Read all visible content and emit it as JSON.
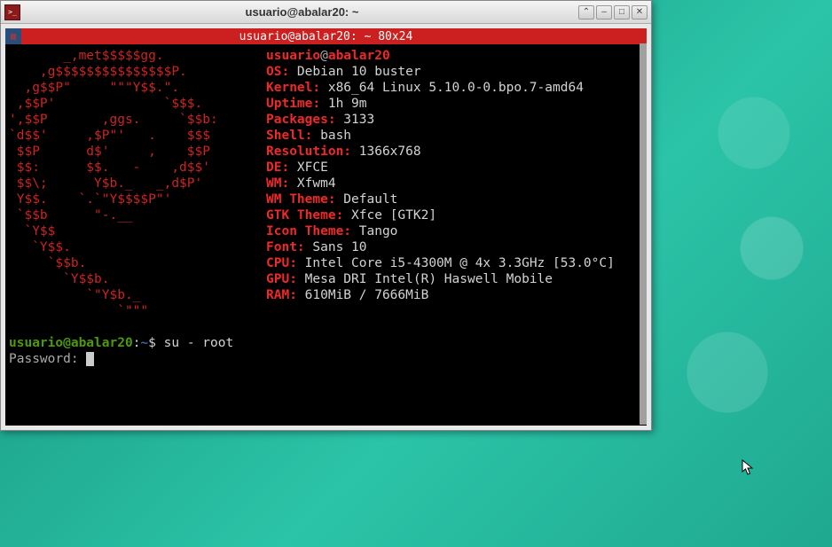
{
  "window": {
    "title": "usuario@abalar20: ~",
    "controls": {
      "up": "⌃",
      "min": "–",
      "max": "□",
      "close": "✕"
    }
  },
  "tab": {
    "title": "usuario@abalar20: ~ 80x24"
  },
  "fetch": {
    "ascii": [
      "       _,met$$$$$gg.",
      "    ,g$$$$$$$$$$$$$$$P.",
      "  ,g$$P\"     \"\"\"Y$$.\".",
      " ,$$P'              `$$$.",
      "',$$P       ,ggs.     `$$b:",
      "`d$$'     ,$P\"'   .    $$$",
      " $$P      d$'     ,    $$P",
      " $$:      $$.   -    ,d$$'",
      " $$\\;      Y$b._   _,d$P'",
      " Y$$.    `.`\"Y$$$$P\"'",
      " `$$b      \"-.__",
      "  `Y$$",
      "   `Y$$.",
      "     `$$b.",
      "       `Y$$b.",
      "          `\"Y$b._",
      "              `\"\"\""
    ],
    "host_user": "usuario",
    "host_at": "@",
    "host_name": "abalar20",
    "info": [
      {
        "label": "OS:",
        "value": " Debian 10 buster"
      },
      {
        "label": "Kernel:",
        "value": " x86_64 Linux 5.10.0-0.bpo.7-amd64"
      },
      {
        "label": "Uptime:",
        "value": " 1h 9m"
      },
      {
        "label": "Packages:",
        "value": " 3133"
      },
      {
        "label": "Shell:",
        "value": " bash"
      },
      {
        "label": "Resolution:",
        "value": " 1366x768"
      },
      {
        "label": "DE:",
        "value": " XFCE"
      },
      {
        "label": "WM:",
        "value": " Xfwm4"
      },
      {
        "label": "WM Theme:",
        "value": " Default"
      },
      {
        "label": "GTK Theme:",
        "value": " Xfce [GTK2]"
      },
      {
        "label": "Icon Theme:",
        "value": " Tango"
      },
      {
        "label": "Font:",
        "value": " Sans 10"
      },
      {
        "label": "CPU:",
        "value": " Intel Core i5-4300M @ 4x 3.3GHz [53.0°C]"
      },
      {
        "label": "GPU:",
        "value": " Mesa DRI Intel(R) Haswell Mobile"
      },
      {
        "label": "RAM:",
        "value": " 610MiB / 7666MiB"
      }
    ]
  },
  "prompt": {
    "user": "usuario@abalar20",
    "sep": ":",
    "path": "~",
    "dollar": "$ ",
    "cmd": "su - root",
    "pwd": "Password: "
  }
}
